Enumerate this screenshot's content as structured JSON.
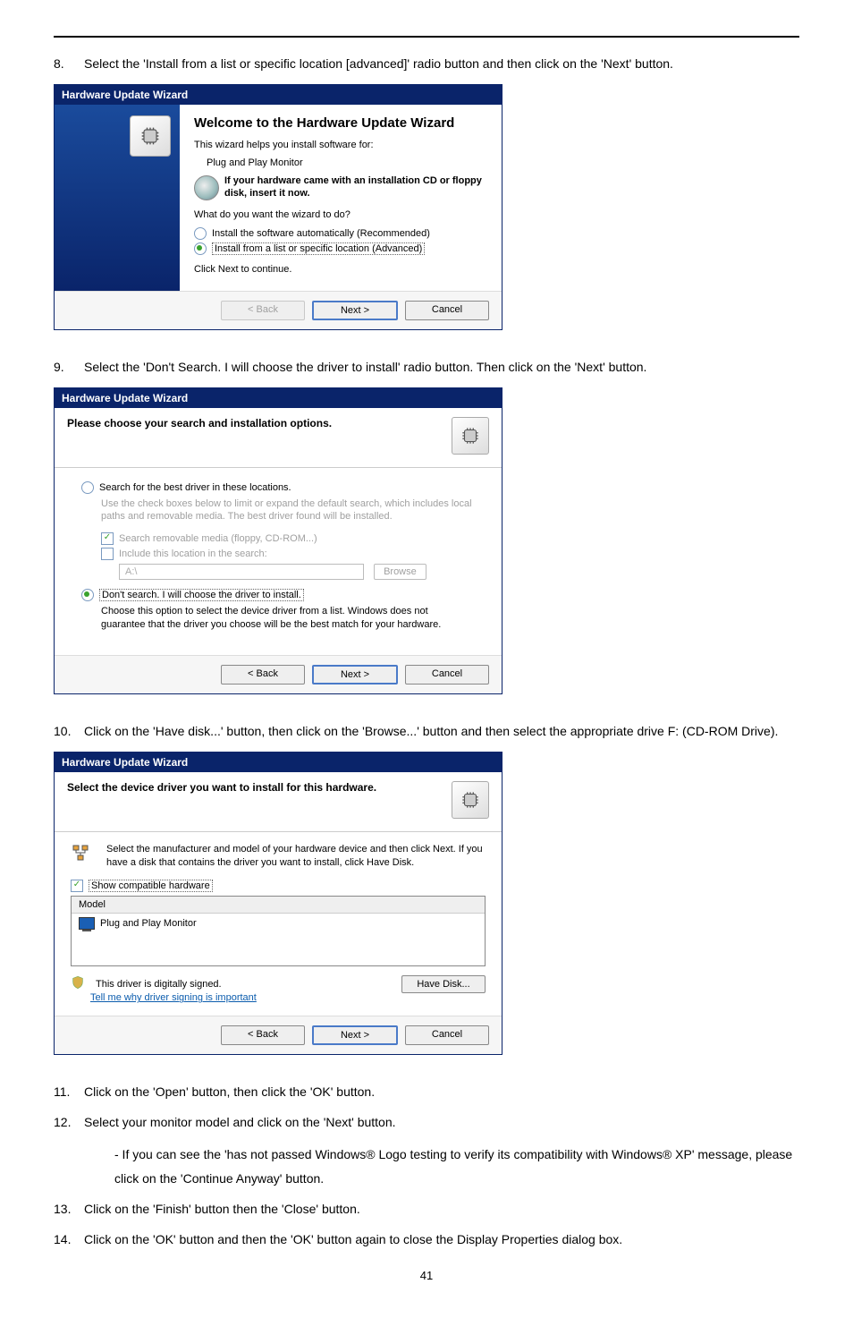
{
  "steps": {
    "s8_num": "8.",
    "s8": "Select the 'Install from a list or specific location [advanced]' radio button and then click on the 'Next' button.",
    "s9_num": "9.",
    "s9": "Select the 'Don't Search. I will choose the driver to install' radio button. Then click on the 'Next' button.",
    "s10_num": "10.",
    "s10": "Click on the 'Have disk...' button, then click on the 'Browse...' button and then select the appropriate drive F: (CD-ROM Drive).",
    "s11_num": "11.",
    "s11": "Click on the 'Open' button, then click the 'OK' button.",
    "s12_num": "12.",
    "s12": "Select your monitor model and click on the 'Next' button.",
    "s12b": "- If you can see the 'has not passed Windows® Logo testing to verify its compatibility with Windows® XP' message, please click on the 'Continue Anyway' button.",
    "s13_num": "13.",
    "s13": "Click on the 'Finish' button then the 'Close' button.",
    "s14_num": "14.",
    "s14": "Click on the 'OK' button and then the 'OK' button again to close the Display Properties dialog box."
  },
  "dlg1": {
    "title": "Hardware Update Wizard",
    "heading": "Welcome to the Hardware Update Wizard",
    "help_line": "This wizard helps you install software for:",
    "device": "Plug and Play Monitor",
    "note": "If your hardware came with an installation CD or floppy disk, insert it now.",
    "question": "What do you want the wizard to do?",
    "opt1": "Install the software automatically (Recommended)",
    "opt2": "Install from a list or specific location (Advanced)",
    "cont": "Click Next to continue.",
    "btn_back": "< Back",
    "btn_next": "Next >",
    "btn_cancel": "Cancel"
  },
  "dlg2": {
    "title": "Hardware Update Wizard",
    "heading": "Please choose your search and installation options.",
    "opt1": "Search for the best driver in these locations.",
    "opt1_desc": "Use the check boxes below to limit or expand the default search, which includes local paths and removable media. The best driver found will be installed.",
    "chk1": "Search removable media (floppy, CD-ROM...)",
    "chk2": "Include this location in the search:",
    "path_value": "A:\\",
    "browse": "Browse",
    "opt2": "Don't search. I will choose the driver to install.",
    "opt2_desc": "Choose this option to select the device driver from a list. Windows does not guarantee that the driver you choose will be the best match for your hardware.",
    "btn_back": "< Back",
    "btn_next": "Next >",
    "btn_cancel": "Cancel"
  },
  "dlg3": {
    "title": "Hardware Update Wizard",
    "heading": "Select the device driver you want to install for this hardware.",
    "instr": "Select the manufacturer and model of your hardware device and then click Next. If you have a disk that contains the driver you want to install, click Have Disk.",
    "chk1": "Show compatible hardware",
    "col_model": "Model",
    "row1": "Plug and Play Monitor",
    "signed": "This driver is digitally signed.",
    "tell_me": "Tell me why driver signing is important",
    "have_disk": "Have Disk...",
    "btn_back": "< Back",
    "btn_next": "Next >",
    "btn_cancel": "Cancel"
  },
  "page_number": "41"
}
